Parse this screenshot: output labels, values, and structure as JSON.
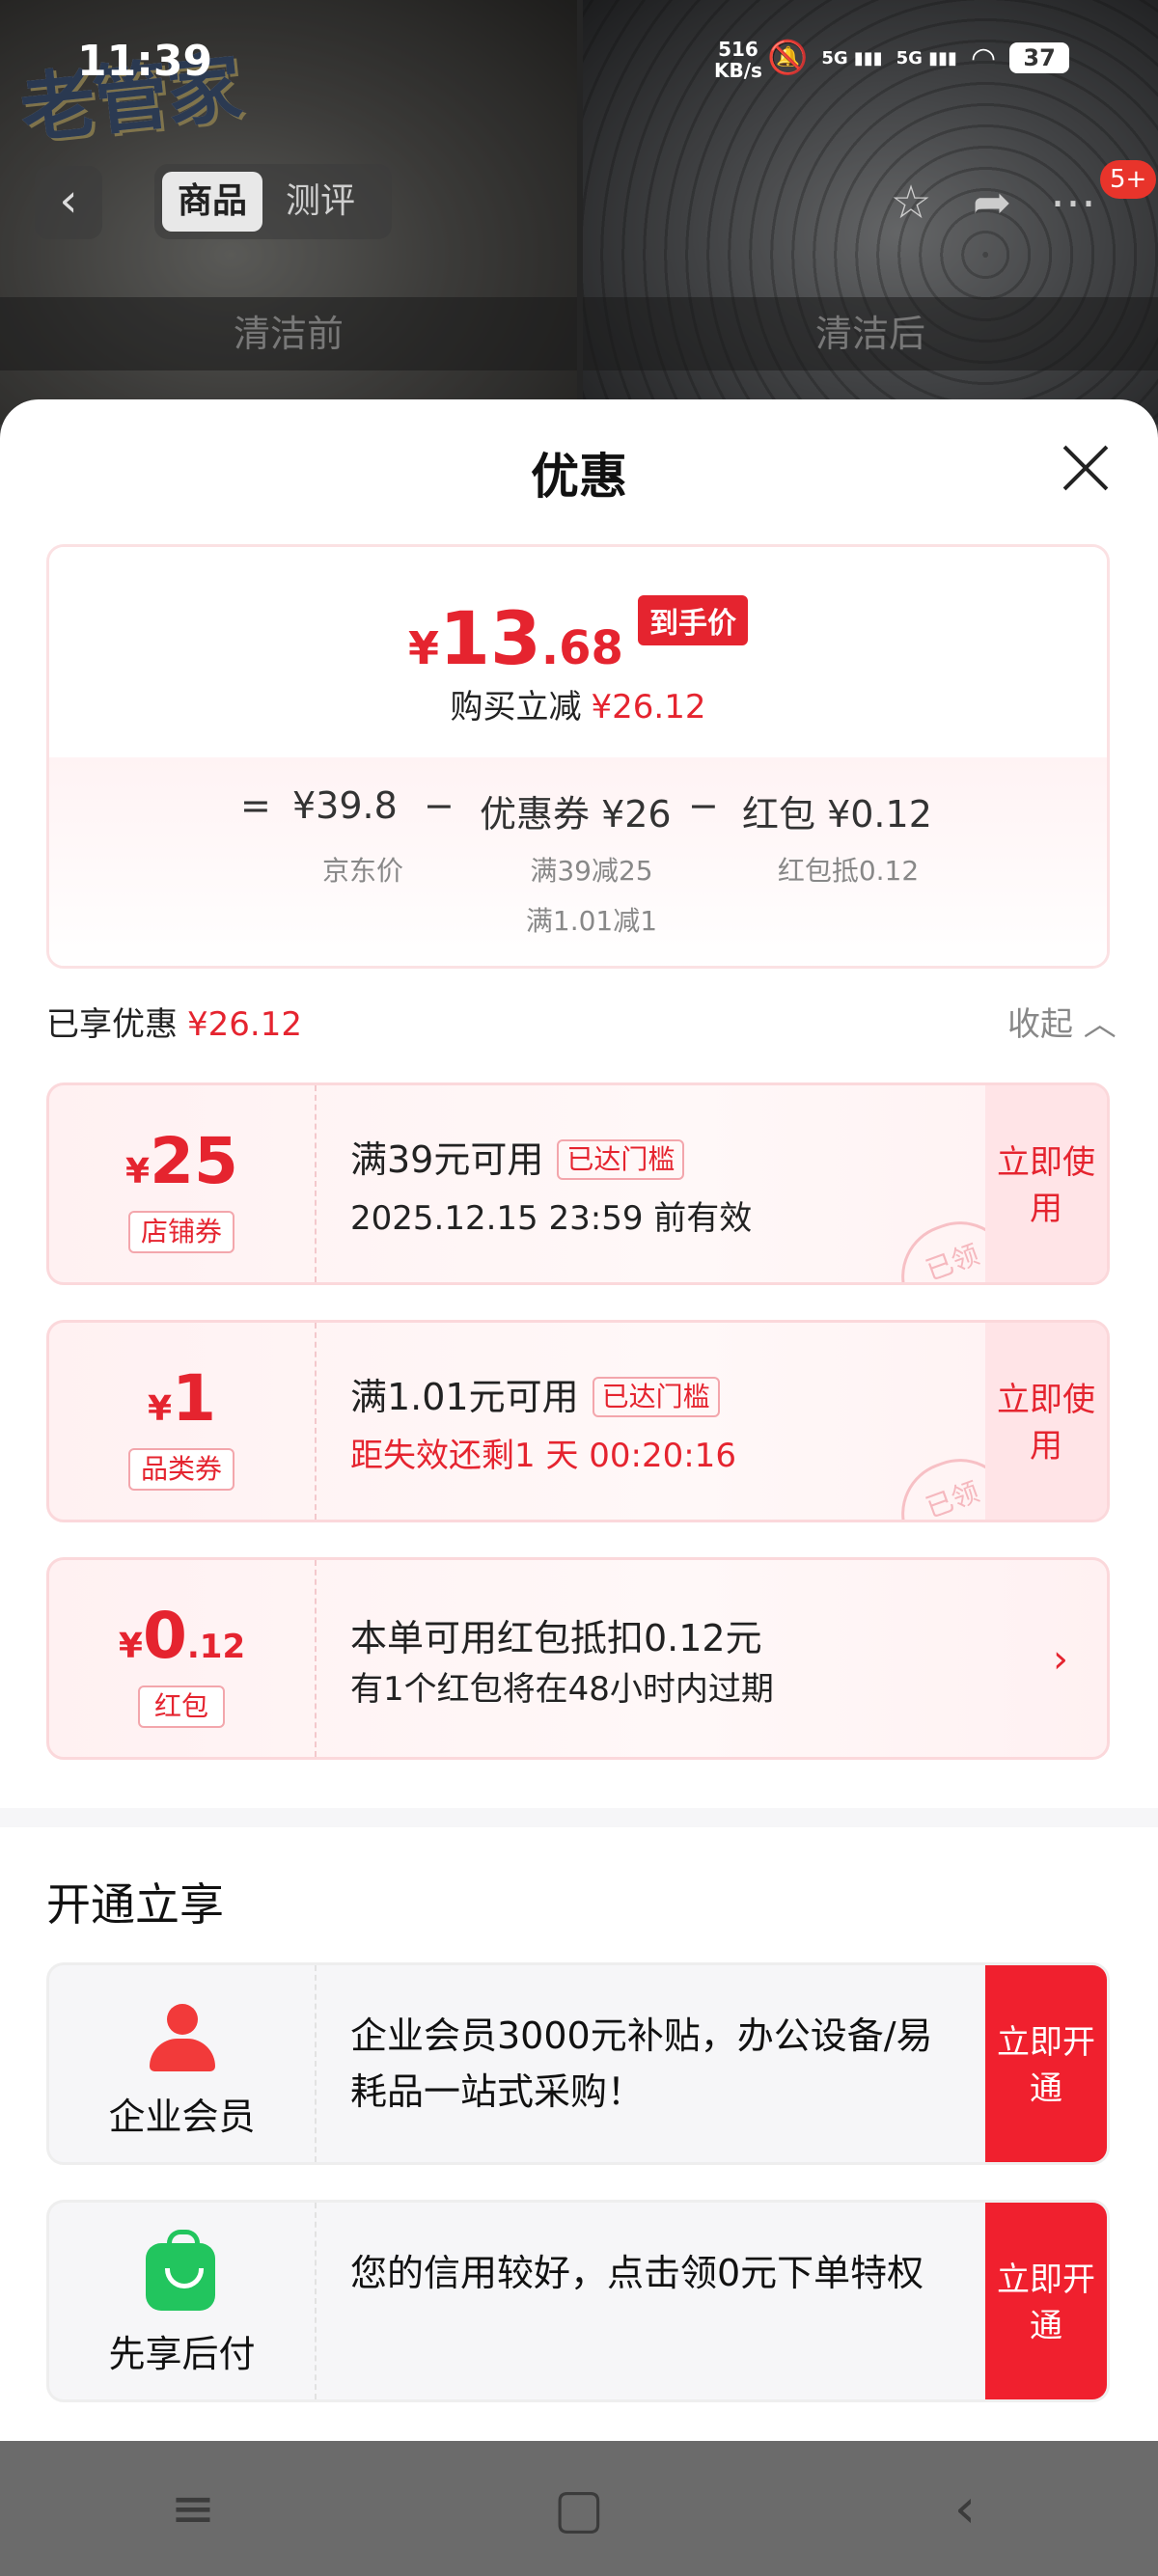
{
  "status_bar": {
    "time": "11:39",
    "net_speed": "516",
    "net_unit": "KB/s",
    "signal1": "5G",
    "signal2": "5G",
    "battery": "37"
  },
  "background": {
    "logo_text": "老管家",
    "caption_left": "清洁前",
    "caption_right": "清洁后"
  },
  "top_nav": {
    "tabs": [
      "商品",
      "测评"
    ],
    "badge": "5+"
  },
  "sheet": {
    "title": "优惠",
    "summary": {
      "currency": "¥",
      "price_int": "13",
      "price_dec": ".68",
      "price_tag": "到手价",
      "reduce_label": "购买立减",
      "reduce_amount": "¥26.12",
      "eq": "=",
      "jd_price": "¥39.8",
      "jd_price_label": "京东价",
      "minus1": "−",
      "coupon_total": "优惠券 ¥26",
      "coupon_detail1": "满39减25",
      "coupon_detail2": "满1.01减1",
      "minus2": "−",
      "redpacket_total": "红包 ¥0.12",
      "redpacket_detail": "红包抵0.12"
    },
    "enjoyed_label": "已享优惠",
    "enjoyed_amount": "¥26.12",
    "collapse_label": "收起 ︿",
    "coupons": [
      {
        "currency": "¥",
        "value": "25",
        "decimal": "",
        "type": "店铺券",
        "condition": "满39元可用",
        "tag": "已达门槛",
        "expiry": "2025.12.15 23:59 前有效",
        "action": "立即使用",
        "stamp": "已领"
      },
      {
        "currency": "¥",
        "value": "1",
        "decimal": "",
        "type": "品类券",
        "condition": "满1.01元可用",
        "tag": "已达门槛",
        "expiry": "距失效还剩1 天 00:20:16",
        "action": "立即使用",
        "stamp": "已领"
      }
    ],
    "redpacket": {
      "currency": "¥",
      "value": "0",
      "decimal": ".12",
      "type": "红包",
      "line1": "本单可用红包抵扣0.12元",
      "line2": "有1个红包将在48小时内过期"
    },
    "open_section_title": "开通立享",
    "services": [
      {
        "label": "企业会员",
        "desc": "企业会员3000元补贴，办公设备/易耗品一站式采购！",
        "action": "立即开通"
      },
      {
        "label": "先享后付",
        "desc": "您的信用较好，点击领0元下单特权",
        "action": "立即开通"
      }
    ]
  },
  "colors": {
    "accent_red": "#e5242f",
    "button_red": "#f0202e",
    "coupon_bg": "#fff1f2"
  }
}
